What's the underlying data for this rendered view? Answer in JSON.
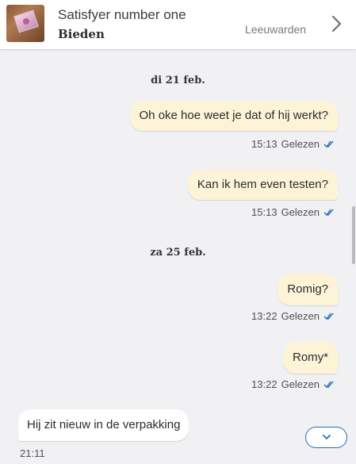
{
  "header": {
    "title": "Satisfyer number one",
    "action": "Bieden",
    "location": "Leeuwarden",
    "thumbnail_icon": "product-thumbnail",
    "chevron_icon": "chevron-right-icon"
  },
  "conversation": {
    "dates": [
      "di 21 feb.",
      "za 25 feb."
    ],
    "messages": [
      {
        "direction": "out",
        "text": "Oh oke hoe weet je dat of hij werkt?",
        "time": "15:13",
        "status": "Gelezen"
      },
      {
        "direction": "out",
        "text": "Kan ik hem even testen?",
        "time": "15:13",
        "status": "Gelezen"
      },
      {
        "direction": "out",
        "text": "Romig?",
        "time": "13:22",
        "status": "Gelezen"
      },
      {
        "direction": "out",
        "text": "Romy*",
        "time": "13:22",
        "status": "Gelezen"
      },
      {
        "direction": "in",
        "text": "Hij zit nieuw in de verpakking",
        "time": "21:11"
      }
    ]
  },
  "colors": {
    "background": "#f1f1f3",
    "outgoing_bubble": "#fdf4d8",
    "incoming_bubble": "#ffffff",
    "read_ticks": "#1f6fb8"
  },
  "scroll_button_icon": "chevron-down-icon"
}
